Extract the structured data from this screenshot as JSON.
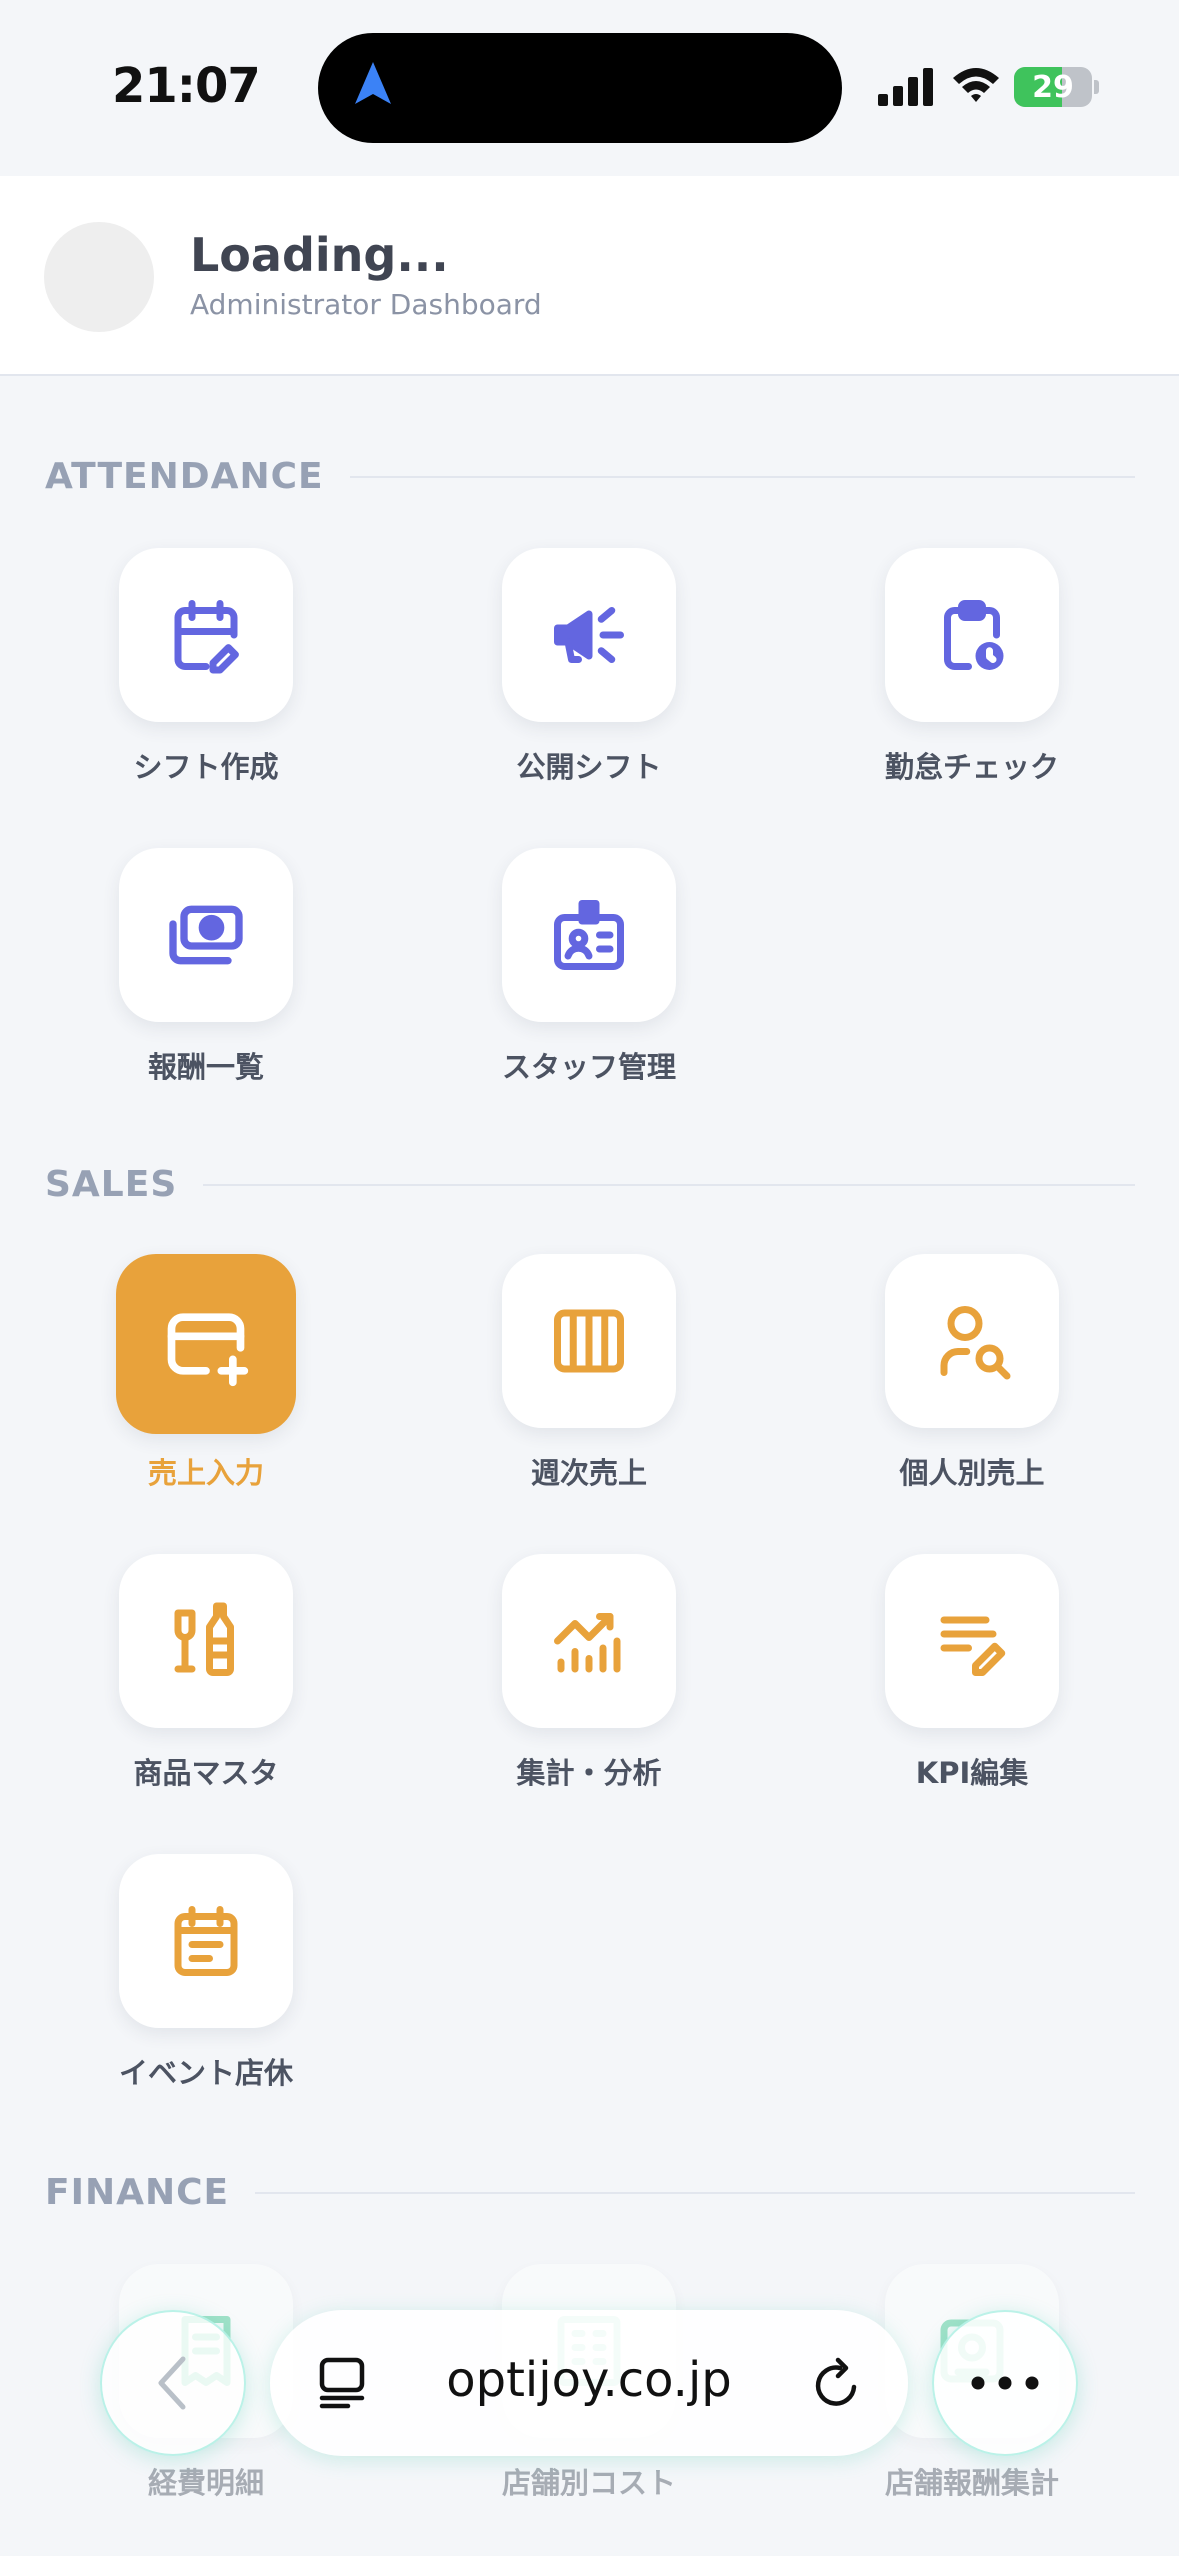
{
  "status_bar": {
    "time": "21:07",
    "battery": "29"
  },
  "header": {
    "title": "Loading...",
    "subtitle": "Administrator Dashboard"
  },
  "sections": {
    "attendance": {
      "title": "ATTENDANCE",
      "items": [
        {
          "label": "シフト作成",
          "icon": "calendar-edit-icon"
        },
        {
          "label": "公開シフト",
          "icon": "megaphone-icon"
        },
        {
          "label": "勤怠チェック",
          "icon": "clipboard-clock-icon"
        },
        {
          "label": "報酬一覧",
          "icon": "cash-icon"
        },
        {
          "label": "スタッフ管理",
          "icon": "id-badge-icon"
        }
      ]
    },
    "sales": {
      "title": "SALES",
      "items": [
        {
          "label": "売上入力",
          "icon": "card-plus-icon"
        },
        {
          "label": "週次売上",
          "icon": "columns-icon"
        },
        {
          "label": "個人別売上",
          "icon": "user-search-icon"
        },
        {
          "label": "商品マスタ",
          "icon": "bottle-glass-icon"
        },
        {
          "label": "集計・分析",
          "icon": "chart-trend-icon"
        },
        {
          "label": "KPI編集",
          "icon": "list-edit-icon"
        },
        {
          "label": "イベント店休",
          "icon": "calendar-note-icon"
        }
      ]
    },
    "finance": {
      "title": "FINANCE",
      "items": [
        {
          "label": "経費明細",
          "icon": "receipt-icon"
        },
        {
          "label": "店舗別コスト",
          "icon": "building-cost-icon"
        },
        {
          "label": "店舗報酬集計",
          "icon": "store-report-icon"
        }
      ]
    }
  },
  "browser": {
    "url": "optijoy.co.jp"
  },
  "colors": {
    "attendance_accent": "#6366e0",
    "sales_accent": "#e8a23b",
    "active_tile": "#e8a23b",
    "section_title": "#97a1b4"
  }
}
